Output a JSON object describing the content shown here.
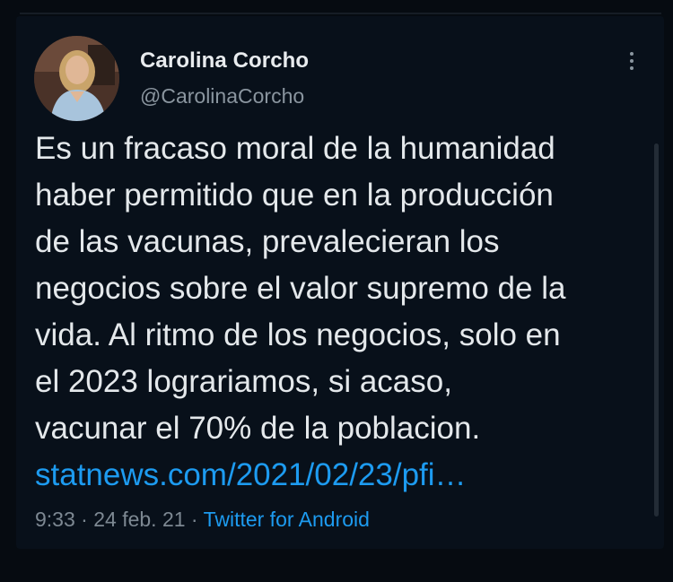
{
  "author": {
    "display_name": "Carolina Corcho",
    "handle": "@CarolinaCorcho"
  },
  "tweet": {
    "lines": [
      "Es un fracaso moral de la humanidad",
      "haber permitido que en la producción",
      "de las vacunas, prevalecieran los",
      "negocios sobre el valor supremo de la",
      "vida. Al ritmo de los negocios, solo en",
      "el 2023 lograriamos, si acaso,",
      "vacunar el 70% de la poblacion."
    ],
    "link": "statnews.com/2021/02/23/pfi…"
  },
  "meta": {
    "time": "9:33",
    "separator": " · ",
    "date": "24 feb. 21",
    "source": "Twitter for Android"
  },
  "colors": {
    "background": "#08101a",
    "text": "#e4e8eb",
    "secondary": "#8a959f",
    "link": "#1d9bf0"
  },
  "icons": {
    "more": "more-vertical-icon"
  }
}
